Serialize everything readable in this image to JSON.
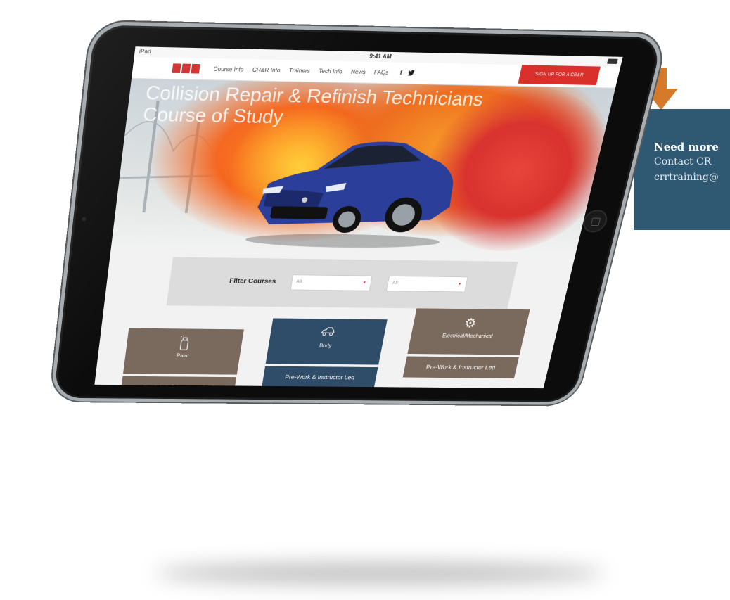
{
  "device": {
    "status_left": "iPad",
    "time": "9:41 AM"
  },
  "nav": {
    "items": [
      "Course Info",
      "CR&R Info",
      "Trainers",
      "Tech Info",
      "News",
      "FAQs"
    ],
    "facebook": "f",
    "twitter": "t",
    "signup": "SIGN UP FOR A CR&R"
  },
  "hero": {
    "line1": "Collision Repair & Refinish Technicians",
    "line2": "Course of Study"
  },
  "filter": {
    "label": "Filter Courses",
    "select1_value": "All",
    "select2_value": "All"
  },
  "cards": [
    {
      "title": "Paint",
      "icon": "spray-can-icon",
      "sub": "Pre-Work & Instructor Led",
      "color": "#7a6a5d"
    },
    {
      "title": "Body",
      "icon": "car-icon",
      "sub": "Pre-Work & Instructor Led",
      "color": "#2f4d69"
    },
    {
      "title": "Electrical/Mechanical",
      "icon": "gear-icon",
      "sub": "Pre-Work & Instructor Led",
      "color": "#7a6a5d"
    }
  ],
  "callout": {
    "title": "Need more",
    "line1": "Contact CR",
    "line2": "crrtraining@",
    "bg_color": "#2f5873",
    "arrow_color": "#d47a2a"
  }
}
